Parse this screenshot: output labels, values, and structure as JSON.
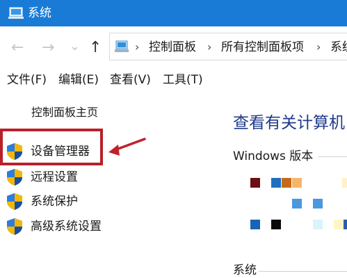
{
  "window": {
    "title": "系统"
  },
  "nav": {
    "back": "←",
    "forward": "→",
    "recent": "⌄",
    "up": "↑"
  },
  "address": {
    "crumbs": [
      "控制面板",
      "所有控制面板项",
      "系统"
    ],
    "separator": "›"
  },
  "menu": [
    "文件(F)",
    "编辑(E)",
    "查看(V)",
    "工具(T)"
  ],
  "sidebar": {
    "home": "控制面板主页",
    "items": [
      {
        "label": "设备管理器",
        "icon": "shield-icon"
      },
      {
        "label": "远程设置",
        "icon": "shield-icon"
      },
      {
        "label": "系统保护",
        "icon": "shield-icon"
      },
      {
        "label": "高级系统设置",
        "icon": "shield-icon"
      }
    ]
  },
  "main": {
    "title": "查看有关计算机",
    "windows_edition": "Windows 版本",
    "system_section": "系统"
  },
  "colors": {
    "titlebar": "#1a7bd6",
    "highlight": "#b8202a",
    "link_title": "#1e3a8a"
  }
}
